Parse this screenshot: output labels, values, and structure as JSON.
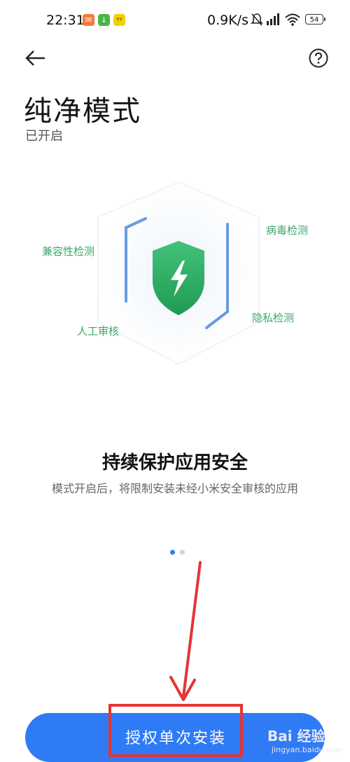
{
  "status_bar": {
    "time": "22:31",
    "network_speed": "0.9K/s",
    "battery": "54",
    "icons": [
      "app-notification-icon",
      "download-icon",
      "app-icon",
      "mute-icon",
      "signal-icon",
      "wifi-icon",
      "battery-icon"
    ]
  },
  "header": {
    "title": "纯净模式",
    "status": "已开启"
  },
  "illustration": {
    "tags": {
      "compatibility": "兼容性检测",
      "virus": "病毒检测",
      "manual": "人工审核",
      "privacy": "隐私检测"
    }
  },
  "content": {
    "headline": "持续保护应用安全",
    "description": "模式开启后，将限制安装未经小米安全审核的应用"
  },
  "pager": {
    "pages": 2,
    "current": 1
  },
  "action": {
    "primary_label": "授权单次安装"
  },
  "watermark": {
    "brand": "Bai 经验",
    "url": "jingyan.baidu.com"
  },
  "colors": {
    "accent": "#2f7bf6",
    "shield_green": "#2fae62",
    "tag_green": "#3aa86a",
    "annotation_red": "#e33535"
  }
}
